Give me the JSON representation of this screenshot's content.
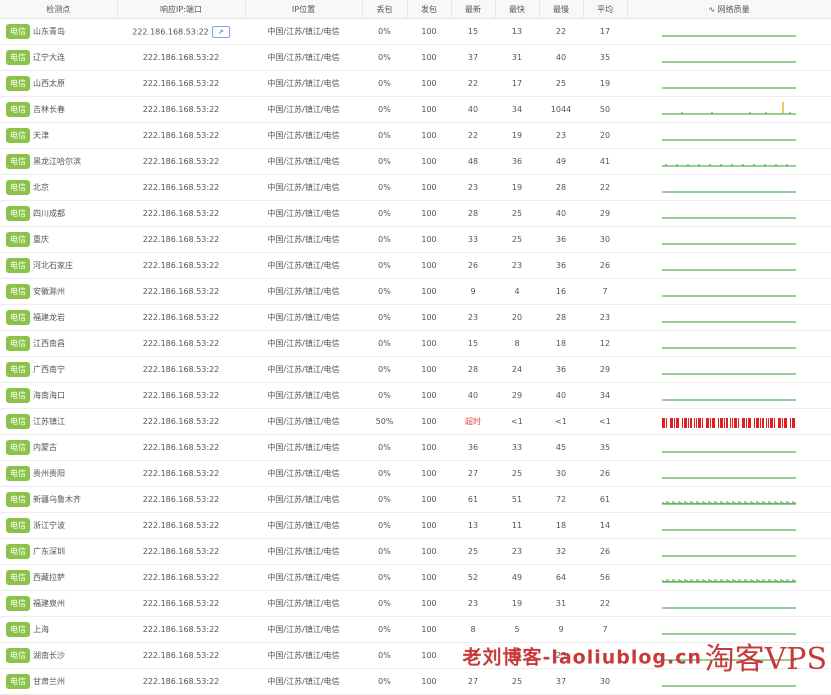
{
  "headers": {
    "loc": "检测点",
    "ip": "响应IP:端口",
    "geo": "IP位置",
    "loss": "丢包",
    "sent": "发包",
    "latest": "最新",
    "fastest": "最快",
    "slowest": "最慢",
    "avg": "平均",
    "quality": "网络质量",
    "quality_icon": "pulse-icon"
  },
  "ip_button_icon": "pin-icon",
  "colors": {
    "tag": "#8bc34a",
    "good": "#2e9e2e",
    "bad": "#e02020",
    "spike": "#e0a800",
    "timeout": "#e04848"
  },
  "rows": [
    {
      "isp": "电信",
      "city": "山东青岛",
      "ip": "222.186.168.53:22",
      "geo": "中国/江苏/镇江/电信",
      "loss": "0%",
      "sent": "100",
      "latest": "15",
      "fastest": "13",
      "slowest": "22",
      "avg": "17",
      "quality": "good"
    },
    {
      "isp": "电信",
      "city": "辽宁大连",
      "ip": "222.186.168.53:22",
      "geo": "中国/江苏/镇江/电信",
      "loss": "0%",
      "sent": "100",
      "latest": "37",
      "fastest": "31",
      "slowest": "40",
      "avg": "35",
      "quality": "good"
    },
    {
      "isp": "电信",
      "city": "山西太原",
      "ip": "222.186.168.53:22",
      "geo": "中国/江苏/镇江/电信",
      "loss": "0%",
      "sent": "100",
      "latest": "22",
      "fastest": "17",
      "slowest": "25",
      "avg": "19",
      "quality": "good"
    },
    {
      "isp": "电信",
      "city": "吉林长春",
      "ip": "222.186.168.53:22",
      "geo": "中国/江苏/镇江/电信",
      "loss": "0%",
      "sent": "100",
      "latest": "40",
      "fastest": "34",
      "slowest": "1044",
      "avg": "50",
      "quality": "spike"
    },
    {
      "isp": "电信",
      "city": "天津",
      "ip": "222.186.168.53:22",
      "geo": "中国/江苏/镇江/电信",
      "loss": "0%",
      "sent": "100",
      "latest": "22",
      "fastest": "19",
      "slowest": "23",
      "avg": "20",
      "quality": "good"
    },
    {
      "isp": "电信",
      "city": "黑龙江哈尔滨",
      "ip": "222.186.168.53:22",
      "geo": "中国/江苏/镇江/电信",
      "loss": "0%",
      "sent": "100",
      "latest": "48",
      "fastest": "36",
      "slowest": "49",
      "avg": "41",
      "quality": "jitter"
    },
    {
      "isp": "电信",
      "city": "北京",
      "ip": "222.186.168.53:22",
      "geo": "中国/江苏/镇江/电信",
      "loss": "0%",
      "sent": "100",
      "latest": "23",
      "fastest": "19",
      "slowest": "28",
      "avg": "22",
      "quality": "good"
    },
    {
      "isp": "电信",
      "city": "四川成都",
      "ip": "222.186.168.53:22",
      "geo": "中国/江苏/镇江/电信",
      "loss": "0%",
      "sent": "100",
      "latest": "28",
      "fastest": "25",
      "slowest": "40",
      "avg": "29",
      "quality": "good"
    },
    {
      "isp": "电信",
      "city": "重庆",
      "ip": "222.186.168.53:22",
      "geo": "中国/江苏/镇江/电信",
      "loss": "0%",
      "sent": "100",
      "latest": "33",
      "fastest": "25",
      "slowest": "36",
      "avg": "30",
      "quality": "good"
    },
    {
      "isp": "电信",
      "city": "河北石家庄",
      "ip": "222.186.168.53:22",
      "geo": "中国/江苏/镇江/电信",
      "loss": "0%",
      "sent": "100",
      "latest": "26",
      "fastest": "23",
      "slowest": "36",
      "avg": "26",
      "quality": "good"
    },
    {
      "isp": "电信",
      "city": "安徽滁州",
      "ip": "222.186.168.53:22",
      "geo": "中国/江苏/镇江/电信",
      "loss": "0%",
      "sent": "100",
      "latest": "9",
      "fastest": "4",
      "slowest": "16",
      "avg": "7",
      "quality": "good"
    },
    {
      "isp": "电信",
      "city": "福建龙岩",
      "ip": "222.186.168.53:22",
      "geo": "中国/江苏/镇江/电信",
      "loss": "0%",
      "sent": "100",
      "latest": "23",
      "fastest": "20",
      "slowest": "28",
      "avg": "23",
      "quality": "good"
    },
    {
      "isp": "电信",
      "city": "江西南昌",
      "ip": "222.186.168.53:22",
      "geo": "中国/江苏/镇江/电信",
      "loss": "0%",
      "sent": "100",
      "latest": "15",
      "fastest": "8",
      "slowest": "18",
      "avg": "12",
      "quality": "good"
    },
    {
      "isp": "电信",
      "city": "广西南宁",
      "ip": "222.186.168.53:22",
      "geo": "中国/江苏/镇江/电信",
      "loss": "0%",
      "sent": "100",
      "latest": "28",
      "fastest": "24",
      "slowest": "36",
      "avg": "29",
      "quality": "good"
    },
    {
      "isp": "电信",
      "city": "海南海口",
      "ip": "222.186.168.53:22",
      "geo": "中国/江苏/镇江/电信",
      "loss": "0%",
      "sent": "100",
      "latest": "40",
      "fastest": "29",
      "slowest": "40",
      "avg": "34",
      "quality": "good"
    },
    {
      "isp": "电信",
      "city": "江苏镇江",
      "ip": "222.186.168.53:22",
      "geo": "中国/江苏/镇江/电信",
      "loss": "50%",
      "sent": "100",
      "latest": "超时",
      "fastest": "<1",
      "slowest": "<1",
      "avg": "<1",
      "quality": "bad",
      "timeout": true
    },
    {
      "isp": "电信",
      "city": "内蒙古",
      "ip": "222.186.168.53:22",
      "geo": "中国/江苏/镇江/电信",
      "loss": "0%",
      "sent": "100",
      "latest": "36",
      "fastest": "33",
      "slowest": "45",
      "avg": "35",
      "quality": "good"
    },
    {
      "isp": "电信",
      "city": "贵州贵阳",
      "ip": "222.186.168.53:22",
      "geo": "中国/江苏/镇江/电信",
      "loss": "0%",
      "sent": "100",
      "latest": "27",
      "fastest": "25",
      "slowest": "30",
      "avg": "26",
      "quality": "good"
    },
    {
      "isp": "电信",
      "city": "新疆乌鲁木齐",
      "ip": "222.186.168.53:22",
      "geo": "中国/江苏/镇江/电信",
      "loss": "0%",
      "sent": "100",
      "latest": "61",
      "fastest": "51",
      "slowest": "72",
      "avg": "61",
      "quality": "noisy"
    },
    {
      "isp": "电信",
      "city": "浙江宁波",
      "ip": "222.186.168.53:22",
      "geo": "中国/江苏/镇江/电信",
      "loss": "0%",
      "sent": "100",
      "latest": "13",
      "fastest": "11",
      "slowest": "18",
      "avg": "14",
      "quality": "good"
    },
    {
      "isp": "电信",
      "city": "广东深圳",
      "ip": "222.186.168.53:22",
      "geo": "中国/江苏/镇江/电信",
      "loss": "0%",
      "sent": "100",
      "latest": "25",
      "fastest": "23",
      "slowest": "32",
      "avg": "26",
      "quality": "good"
    },
    {
      "isp": "电信",
      "city": "西藏拉萨",
      "ip": "222.186.168.53:22",
      "geo": "中国/江苏/镇江/电信",
      "loss": "0%",
      "sent": "100",
      "latest": "52",
      "fastest": "49",
      "slowest": "64",
      "avg": "56",
      "quality": "noisy"
    },
    {
      "isp": "电信",
      "city": "福建泉州",
      "ip": "222.186.168.53:22",
      "geo": "中国/江苏/镇江/电信",
      "loss": "0%",
      "sent": "100",
      "latest": "23",
      "fastest": "19",
      "slowest": "31",
      "avg": "22",
      "quality": "good"
    },
    {
      "isp": "电信",
      "city": "上海",
      "ip": "222.186.168.53:22",
      "geo": "中国/江苏/镇江/电信",
      "loss": "0%",
      "sent": "100",
      "latest": "8",
      "fastest": "5",
      "slowest": "9",
      "avg": "7",
      "quality": "good"
    },
    {
      "isp": "电信",
      "city": "湖南长沙",
      "ip": "222.186.168.53:22",
      "geo": "中国/江苏/镇江/电信",
      "loss": "0%",
      "sent": "100",
      "latest": "19",
      "fastest": "15",
      "slowest": "25",
      "avg": "",
      "quality": "good"
    },
    {
      "isp": "电信",
      "city": "甘肃兰州",
      "ip": "222.186.168.53:22",
      "geo": "中国/江苏/镇江/电信",
      "loss": "0%",
      "sent": "100",
      "latest": "27",
      "fastest": "25",
      "slowest": "37",
      "avg": "30",
      "quality": "good"
    }
  ],
  "watermark": {
    "blog": "老刘博客-laoliublog.cn",
    "brand": "淘客VPS"
  }
}
